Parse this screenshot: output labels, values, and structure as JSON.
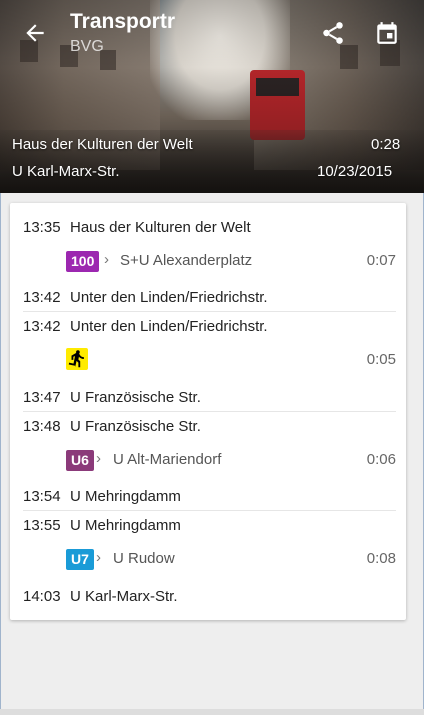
{
  "app": {
    "title": "Transportr",
    "subtitle": "BVG"
  },
  "header": {
    "from_stop": "Haus der Kulturen der Welt",
    "to_stop": "U Karl-Marx-Str.",
    "duration": "0:28",
    "date": "10/23/2015"
  },
  "trip": {
    "legs": [
      {
        "dep_time": "13:35",
        "dep_stop": "Haus der Kulturen der Welt",
        "line": "100",
        "line_color": "#9c27b0",
        "direction": "S+U Alexanderplatz",
        "duration": "0:07",
        "arr_time": "13:42",
        "arr_stop": "Unter den Linden/Friedrichstr."
      },
      {
        "dep_time": "13:42",
        "dep_stop": "Unter den Linden/Friedrichstr.",
        "type": "walk",
        "icon": "walk-icon",
        "duration": "0:05",
        "arr_time": "13:47",
        "arr_stop": "U Französische Str."
      },
      {
        "dep_time": "13:48",
        "dep_stop": "U Französische Str.",
        "line": "U6",
        "line_color": "#8b3a7a",
        "direction": "U Alt-Mariendorf",
        "duration": "0:06",
        "arr_time": "13:54",
        "arr_stop": "U Mehringdamm"
      },
      {
        "dep_time": "13:55",
        "dep_stop": "U Mehringdamm",
        "line": "U7",
        "line_color": "#1a9bd7",
        "direction": "U Rudow",
        "duration": "0:08",
        "arr_time": "14:03",
        "arr_stop": "U Karl-Marx-Str."
      }
    ]
  },
  "icons": {
    "back": "arrow-back-icon",
    "share": "share-icon",
    "calendar": "calendar-icon",
    "chevron": "chevron-right-icon"
  },
  "colors": {
    "walk_badge": "#ffeb00"
  }
}
